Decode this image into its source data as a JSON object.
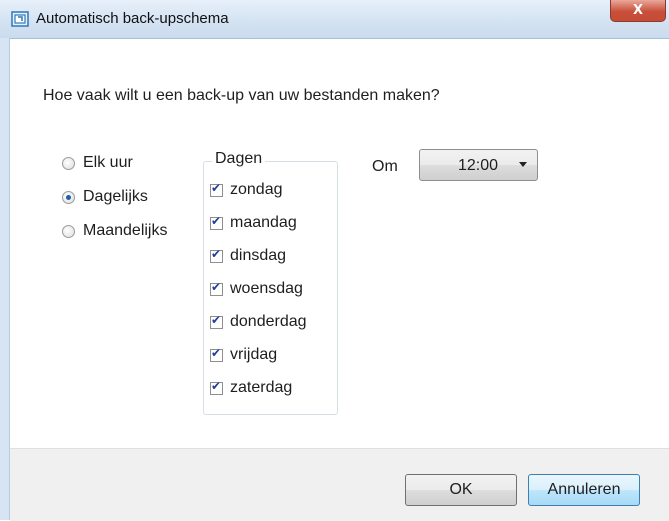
{
  "window": {
    "title": "Automatisch back-upschema",
    "close_label": "X"
  },
  "question": "Hoe vaak wilt u een back-up van uw bestanden maken?",
  "frequency": {
    "options": [
      {
        "label": "Elk uur",
        "checked": false
      },
      {
        "label": "Dagelijks",
        "checked": true
      },
      {
        "label": "Maandelijks",
        "checked": false
      }
    ]
  },
  "days": {
    "group_title": "Dagen",
    "items": [
      {
        "label": "zondag",
        "checked": true
      },
      {
        "label": "maandag",
        "checked": true
      },
      {
        "label": "dinsdag",
        "checked": true
      },
      {
        "label": "woensdag",
        "checked": true
      },
      {
        "label": "donderdag",
        "checked": true
      },
      {
        "label": "vrijdag",
        "checked": true
      },
      {
        "label": "zaterdag",
        "checked": true
      }
    ]
  },
  "time": {
    "label": "Om",
    "value": "12:00"
  },
  "buttons": {
    "ok": "OK",
    "cancel": "Annuleren"
  },
  "colors": {
    "titlebar": "#d3e2f2",
    "close_button": "#c8503a",
    "accent": "#1d5fa8"
  }
}
